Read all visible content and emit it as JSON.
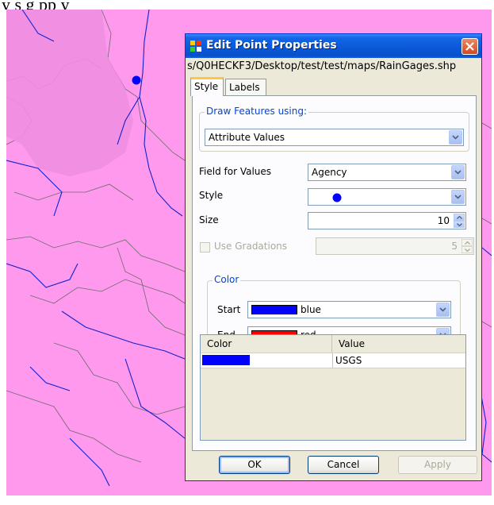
{
  "caption": {
    "text": "y s   g pp   y"
  },
  "dialog": {
    "title": "Edit Point Properties",
    "path": "s/Q0HECKF3/Desktop/test/test/maps/RainGages.shp",
    "tabs": [
      {
        "label": "Style",
        "active": true
      },
      {
        "label": "Labels",
        "active": false
      }
    ],
    "draw_group": {
      "title": "Draw Features using:",
      "value": "Attribute Values"
    },
    "field_for_values": {
      "label": "Field for Values",
      "value": "Agency"
    },
    "style": {
      "label": "Style",
      "marker_color": "#0000ff"
    },
    "size": {
      "label": "Size",
      "value": "10"
    },
    "gradations": {
      "label": "Use Gradations",
      "value": "5",
      "checked": false
    },
    "color_group": {
      "title": "Color",
      "start": {
        "label": "Start",
        "value": "blue",
        "color": "#0000ff"
      },
      "end": {
        "label": "End",
        "value": "red",
        "color": "#ff0000"
      }
    },
    "table": {
      "headers": [
        "Color",
        "Value"
      ],
      "rows": [
        {
          "color": "#0000ff",
          "value": "USGS"
        }
      ]
    },
    "buttons": {
      "ok": "OK",
      "cancel": "Cancel",
      "apply": "Apply"
    }
  },
  "colors": {
    "map_fill_light": "#ff99ee",
    "map_fill_dark": "#ee88dd",
    "rivers": "#1122cc",
    "titlebar": "#0a58d6",
    "accent": "#0046d5"
  }
}
